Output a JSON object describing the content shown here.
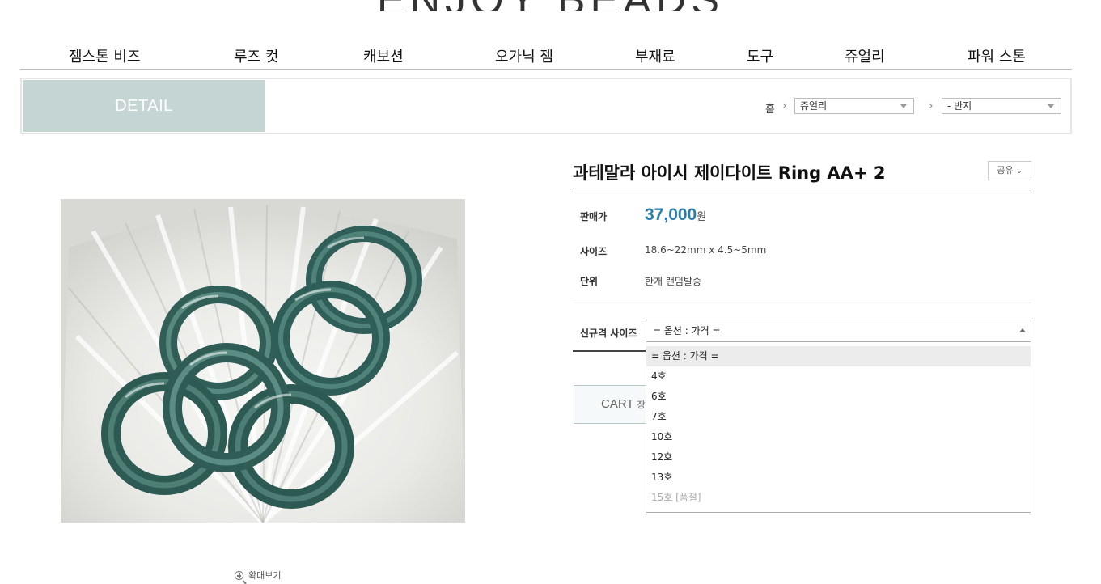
{
  "site": {
    "logo": "ENJOY BEADS"
  },
  "nav": [
    {
      "label": "젬스톤 비즈"
    },
    {
      "label": "루즈 컷"
    },
    {
      "label": "캐보션"
    },
    {
      "label": "오가닉 젬"
    },
    {
      "label": "부재료"
    },
    {
      "label": "도구"
    },
    {
      "label": "쥬얼리"
    },
    {
      "label": "파워 스톤"
    }
  ],
  "detail_bar": {
    "tab_label": "DETAIL",
    "breadcrumb_home": "홈",
    "category_select": "쥬얼리",
    "subcategory_select": "- 반지"
  },
  "product": {
    "title": "과테말라 아이시 제이다이트 Ring AA+ 2",
    "share_label": "공유",
    "price_label": "판매가",
    "price_value": "37,000",
    "price_unit": "원",
    "size_label": "사이즈",
    "size_value": "18.6~22mm x 4.5~5mm",
    "unit_label": "단위",
    "unit_value": "한개 랜덤발송",
    "zoom_label": "확대보기",
    "image_alt": "green jadeite rings in white shell dish"
  },
  "option": {
    "label": "신규격 사이즈",
    "selected": "= 옵션 : 가격 =",
    "items": [
      {
        "label": "= 옵션 : 가격 =",
        "state": "selected"
      },
      {
        "label": "4호",
        "state": "normal"
      },
      {
        "label": "6호",
        "state": "normal"
      },
      {
        "label": "7호",
        "state": "normal"
      },
      {
        "label": "10호",
        "state": "normal"
      },
      {
        "label": "12호",
        "state": "normal"
      },
      {
        "label": "13호",
        "state": "normal"
      },
      {
        "label": "15호 [품절]",
        "state": "disabled"
      }
    ]
  },
  "cart": {
    "label": "CART",
    "sub_label": "장바구니"
  },
  "colors": {
    "accent": "#2a7fb0",
    "tab_bg": "#c5d5d4",
    "ring_jade": "#3f6f66"
  }
}
